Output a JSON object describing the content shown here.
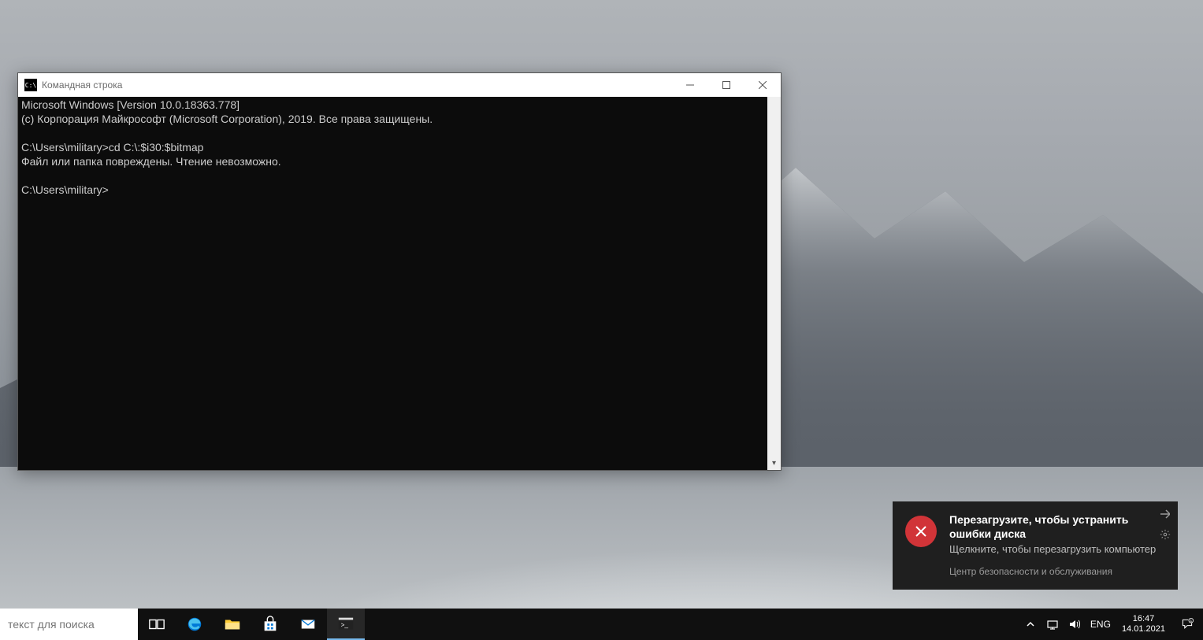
{
  "window": {
    "title": "Командная строка",
    "icon_label": "C:\\"
  },
  "terminal": {
    "line1": "Microsoft Windows [Version 10.0.18363.778]",
    "line2": "(c) Корпорация Майкрософт (Microsoft Corporation), 2019. Все права защищены.",
    "blank1": "",
    "prompt1": "C:\\Users\\military>cd C:\\:$i30:$bitmap",
    "error": "Файл или папка повреждены. Чтение невозможно.",
    "blank2": "",
    "prompt2": "C:\\Users\\military>"
  },
  "toast": {
    "title": "Перезагрузите, чтобы устранить ошибки диска",
    "subtitle": "Щелкните, чтобы перезагрузить компьютер",
    "source": "Центр безопасности и обслуживания"
  },
  "taskbar": {
    "search_placeholder": "текст для поиска",
    "lang": "ENG",
    "time": "16:47",
    "date": "14.01.2021",
    "notification_count": "1"
  }
}
